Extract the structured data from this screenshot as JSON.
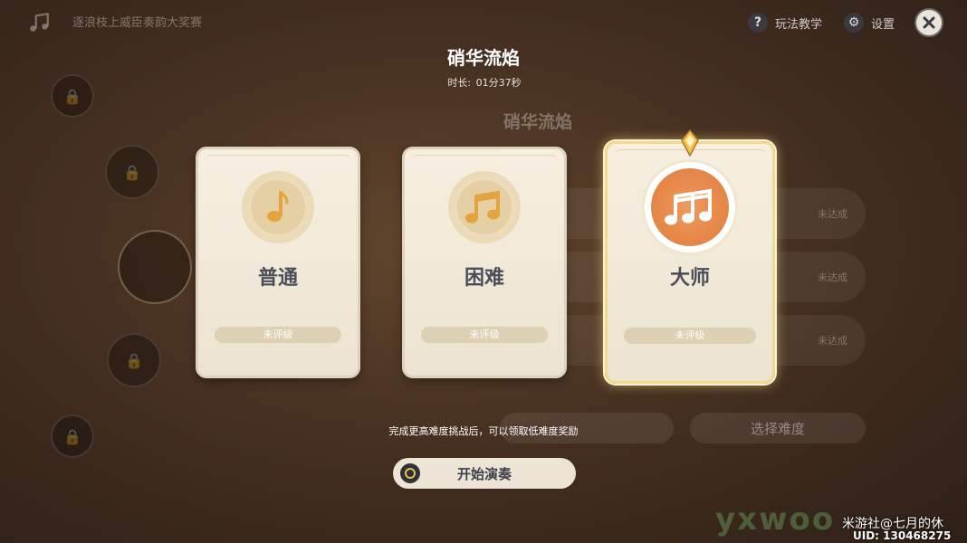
{
  "topbar": {
    "event_title": "逐浪枝上威臣奏韵大奖赛",
    "tutorial_label": "玩法教学",
    "settings_label": "设置"
  },
  "song": {
    "title": "硝华流焰",
    "duration_label": "时长:",
    "duration_value": "01分37秒"
  },
  "background": {
    "title": "硝华流焰",
    "rows": [
      {
        "status": "未达成"
      },
      {
        "status": "未达成"
      },
      {
        "status": "未达成"
      }
    ],
    "buttons": [
      "选择难度"
    ]
  },
  "difficulties": [
    {
      "label": "普通",
      "rating": "未评级",
      "icon": "single-note-icon",
      "selected": false
    },
    {
      "label": "困难",
      "rating": "未评级",
      "icon": "double-note-icon",
      "selected": false
    },
    {
      "label": "大师",
      "rating": "未评级",
      "icon": "triple-note-icon",
      "selected": true
    }
  ],
  "hint": "完成更高难度挑战后，可以领取低难度奖励",
  "start_button": "开始演奏",
  "watermark": {
    "brand": "yxwoo",
    "author": "米游社@七月的休",
    "uid": "UID: 130468275"
  },
  "colors": {
    "card_bg": "#f6efe1",
    "selected_border": "#f3d98a",
    "master_emblem": "#e07c3c",
    "label_text": "#4c4c5a"
  }
}
